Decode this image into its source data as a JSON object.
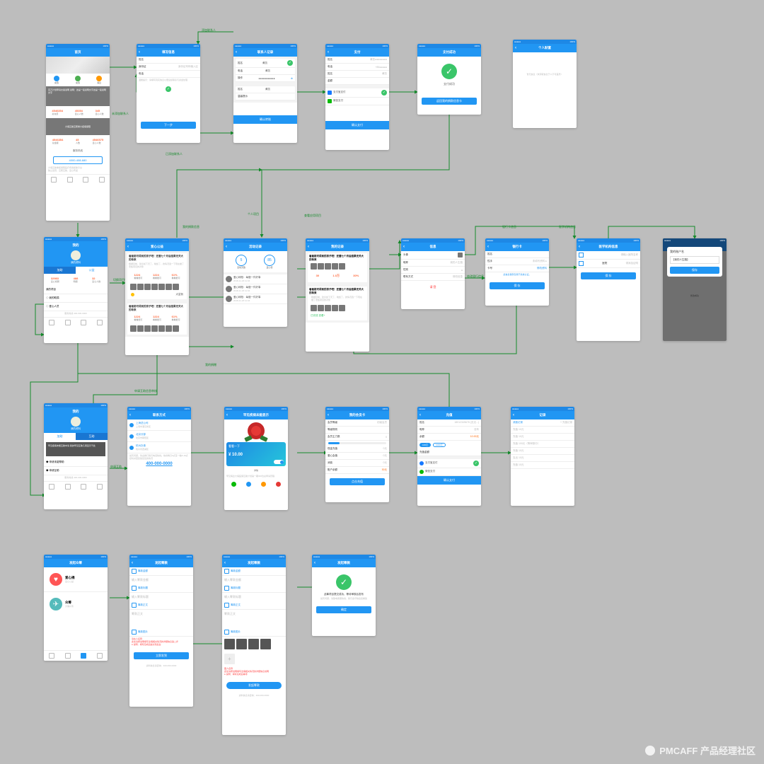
{
  "watermark": "PMCAFF 产品经理社区",
  "labels": {
    "add_contact": "添加联系人",
    "install_contact": "未添加联系人",
    "batch_contact": "已添加联系人",
    "personal_project": "个人项目",
    "view_project": "查看应用项目",
    "to_bank_detail": "修改银行信息",
    "bank_card_info": "医学机构信息",
    "to_bank_card": "银行卡信息",
    "toggle_project": "切换项目列表",
    "view_donation": "我的捐款信息",
    "my_donations": "我的捐赠",
    "apply_donate": "申请互助",
    "confirm_info": "申请互助信息审核"
  },
  "r1": {
    "home": {
      "title": "首页",
      "chip1": "充值",
      "chip2": "充值",
      "chip3": "消息",
      "banner": "百万计划申请文案说明\n说明：这是一段说明文字这是一段说明文字",
      "stats": [
        [
          "4546354",
          "45354",
          "345"
        ],
        [
          "总充值",
          "爱心人数",
          "爱心人数"
        ]
      ],
      "phone_title": "服务热线",
      "phone": "4000-408-680",
      "sub": "大病互助互帮重大疾病保障",
      "card2": [
        [
          "4546354",
          "45",
          "4546575"
        ],
        [
          "总金额",
          "人数",
          "爱心人数"
        ]
      ]
    },
    "fill": {
      "title": "填写信息",
      "rows": [
        [
          "姓名",
          ""
        ],
        [
          "身份证",
          "身份证号码输入区"
        ],
        [
          "电话",
          ""
        ]
      ],
      "note": "温馨提示：请填写真实信息以便后续联系与资金处理",
      "btn": "下一步"
    },
    "contact": {
      "title": "联系人记录",
      "rows": [
        [
          "姓名",
          "黄凯",
          "✓"
        ],
        [
          "电话",
          "黄凯",
          ""
        ],
        [
          "操作",
          "●●●●●●●●●●●",
          ""
        ]
      ],
      "sub": "温馨提示",
      "btn": "确认转账"
    },
    "pay": {
      "title": "支付",
      "rows": [
        [
          "姓名",
          "黄凯●●●●●●●●"
        ],
        [
          "电话",
          "+86●●●●●"
        ],
        [
          "姓名",
          "黄凯"
        ],
        [
          "金额",
          ""
        ]
      ],
      "methods": [
        [
          "支付宝支付",
          "zhifubao",
          "✓"
        ],
        [
          "微信支付",
          "wechat",
          ""
        ]
      ],
      "btn": "确认支付"
    },
    "ok": {
      "title": "支付成功",
      "msg": "支付成功",
      "btn": "返回我的捐款信息卡"
    },
    "balance": {
      "title": "个人财富",
      "blank": "暂无信息（未获取信息于人不可差异）"
    }
  },
  "r2": {
    "me": {
      "title": "我的",
      "name": "我的资料",
      "tabs": [
        "加助",
        "公益"
      ],
      "stats": [
        [
          "32983",
          "488",
          "32"
        ],
        [
          "爱心捐赠",
          "明细",
          "爱心人数"
        ]
      ],
      "menu": [
        "我的项目",
        "◇ 我的助捐",
        "◇ 爱心人员"
      ],
      "phone": "服务热线\n400-000-0000"
    },
    "list": {
      "title": "爱心公益",
      "card_title": "看看能可得到的孩子吧！还差七个月后结果无关大的希来",
      "sub": "根据目前，建议如下天了，晚饭了，的情况选一下现在做了老板项目的对象",
      "stats": [
        [
          "1224",
          "1224",
          "61%"
        ],
        [
          "看看能可",
          "看看能可",
          "看看能可"
        ]
      ],
      "author": "大富翁"
    },
    "track": {
      "title": "活动记录",
      "circ": [
        "5",
        "85"
      ],
      "clbl": [
        "活动天数",
        "爱心值"
      ],
      "item": "爱心转账：每做一件好事",
      "time": "2018-11-18  11:04"
    },
    "myp": {
      "title": "我的记录",
      "card_title": "看看能可得到的孩子吧！还差七个月后结果无关大的希来",
      "tag": "已完成   查看+"
    },
    "info": {
      "title": "信息",
      "rows": [
        [
          "头像",
          ""
        ],
        [
          "昵称",
          "我的人生路"
        ],
        [
          "性别",
          "●"
        ],
        [
          "联系方式",
          "●●●●●●●●●●"
        ]
      ],
      "del": "请 登",
      "edit": "修改信息"
    },
    "bank": {
      "title": "银行卡",
      "rows": [
        [
          "姓名",
          "",
          ""
        ],
        [
          "性手",
          "未填写资料 ▸",
          ""
        ],
        [
          "卡号",
          "",
          "修改资料"
        ],
        [
          "",
          "保 存",
          ""
        ]
      ],
      "btn": "保 存",
      "note": "此信息保存仅用于系统认证。"
    },
    "hosp": {
      "title": "医学机构信息",
      "row1": "请输入医院名称",
      "row2": "医院",
      "btn": "保 存",
      "r": "请添加证明"
    },
    "modal": {
      "title": "我的账户名",
      "input": "【我的人生路】",
      "btn": "保存",
      "retry": "修改成功"
    }
  },
  "r3": {
    "me2": {
      "title": "我的",
      "name": "我的资料",
      "tabs": [
        "加助",
        "互助"
      ],
      "banner": "罕见疾病未能互助中请\n我的罕见互助几项显示于此",
      "menu": [
        "◆ 申请未能帮助",
        "◆ 申请互助"
      ],
      "phone": "服务热线\n400-000-0000"
    },
    "contact2": {
      "title": "联系方式",
      "items": [
        [
          "上海总公司",
          "上海市浦东新区"
        ],
        [
          "北京分部",
          "北京市朝阳区"
        ],
        [
          "杭州办事",
          "杭州市西湖区"
        ]
      ],
      "note": "如有问题，欢迎拨打我们电话热线。热线每日9点至一晚8-18点接听并回复答复您的情况",
      "phone": "400-000-0000"
    },
    "detail": {
      "title": "罕见疾病未能显示",
      "hero": "看看一下",
      "amt": "¥ 10.00",
      "body": "罕见病患大病医保互助计划第一期300位总申请历程"
    },
    "acct": {
      "title": "我的会员卡",
      "rows": [
        [
          "会员等级",
          "初级会员"
        ],
        [
          "等级规则",
          ""
        ],
        [
          "会员主力数",
          "0"
        ]
      ],
      "bar": "",
      "rows2": [
        [
          "现金充值",
          "0元"
        ],
        [
          "爱心会值",
          "0元"
        ],
        [
          "消费",
          "0元"
        ],
        [
          "账户余额",
          "30元"
        ]
      ],
      "btn": "点击充值"
    },
    "topup": {
      "title": "充值",
      "rows": [
        [
          "姓名",
          "18012345678  (无法...)"
        ],
        [
          "昵称",
          "没有"
        ],
        [
          "余额",
          "10.00元"
        ]
      ],
      "opts": [
        "100元",
        "1000元"
      ],
      "row2": [
        "充值金额",
        ""
      ],
      "methods": [
        [
          "支付宝支付",
          "✓"
        ],
        [
          "微信支付",
          ""
        ]
      ],
      "btn": "确认支付"
    },
    "rec": {
      "title": "记录",
      "col": [
        "消费记录",
        "+ 充值记录"
      ],
      "rows": [
        "充值 10元",
        "充值 10元",
        "充值 100元（等审核中）",
        "充值 10元",
        "支出 10元",
        "充值 10元"
      ]
    }
  },
  "r4": {
    "aid": {
      "title": "发起众筹",
      "a": "爱心捐",
      "b": "众筹"
    },
    "f1": {
      "title": "发起筹款",
      "secs": [
        "筹款金额",
        "筹款标题",
        "筹款正文",
        "筹款图片"
      ],
      "ph1": "输入筹款金额",
      "ph2": "输入筹款标题",
      "ph3": "筹款正文",
      "note": "请在人名称\n此处请按说明填写患病相关情况的详细信息第二步\n● 说明：填写完成后提交到后台",
      "btn": "立即发到",
      "phone": "资料信息请咨询：400-000-0000"
    },
    "f2": {
      "title": "发起筹款",
      "secs": [
        "筹款金额",
        "筹款标题",
        "筹款正文",
        "筹款图片"
      ],
      "ph1": "输入筹款金额",
      "ph2": "输入筹款标题",
      "ph3": "筹款正文",
      "note": "图人名称\n此处请按说明填写患病相关情况的详细信息说明\n● 说明：填写完成后等待",
      "btn": "发起筹款",
      "phone": "资料信息请咨询：400-000-0000"
    },
    "ok": {
      "title": "发起筹款",
      "msg": "此筹项目提交成功，等待审核后发布",
      "btn": "确定",
      "note": "如有问题，请致电客服热线，我们会尽快给您解答"
    }
  }
}
